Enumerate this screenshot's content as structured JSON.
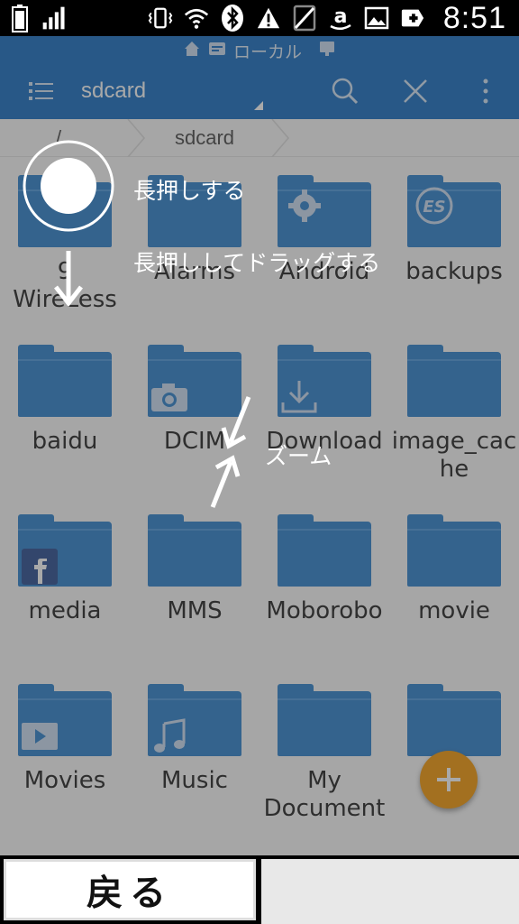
{
  "statusbar": {
    "time": "8:51"
  },
  "header": {
    "location": "ローカル",
    "path_title": "sdcard"
  },
  "breadcrumb": {
    "root": "/",
    "current": "sdcard"
  },
  "folders": [
    {
      "name": "9\nWireLess",
      "badge": ""
    },
    {
      "name": "Alarms",
      "badge": ""
    },
    {
      "name": "Android",
      "badge": "gear"
    },
    {
      "name": "backups",
      "badge": "es"
    },
    {
      "name": "baidu",
      "badge": ""
    },
    {
      "name": "DCIM",
      "badge": "camera"
    },
    {
      "name": "Download",
      "badge": "download"
    },
    {
      "name": "image_cac\nhe",
      "badge": ""
    },
    {
      "name": "media",
      "badge": "facebook"
    },
    {
      "name": "MMS",
      "badge": ""
    },
    {
      "name": "Moborobo",
      "badge": ""
    },
    {
      "name": "movie",
      "badge": ""
    },
    {
      "name": "Movies",
      "badge": "play"
    },
    {
      "name": "Music",
      "badge": "music"
    },
    {
      "name": "My\nDocument",
      "badge": ""
    },
    {
      "name": "",
      "badge": ""
    }
  ],
  "tutorial": {
    "long_press": "長押しする",
    "long_press_drag": "長押ししてドラッグする",
    "zoom": "ズーム"
  },
  "bottombar": {
    "back_label": "戻る"
  },
  "colors": {
    "primary": "#2979c6",
    "folder": "#3d8ad0",
    "fab": "#f6a11c"
  }
}
